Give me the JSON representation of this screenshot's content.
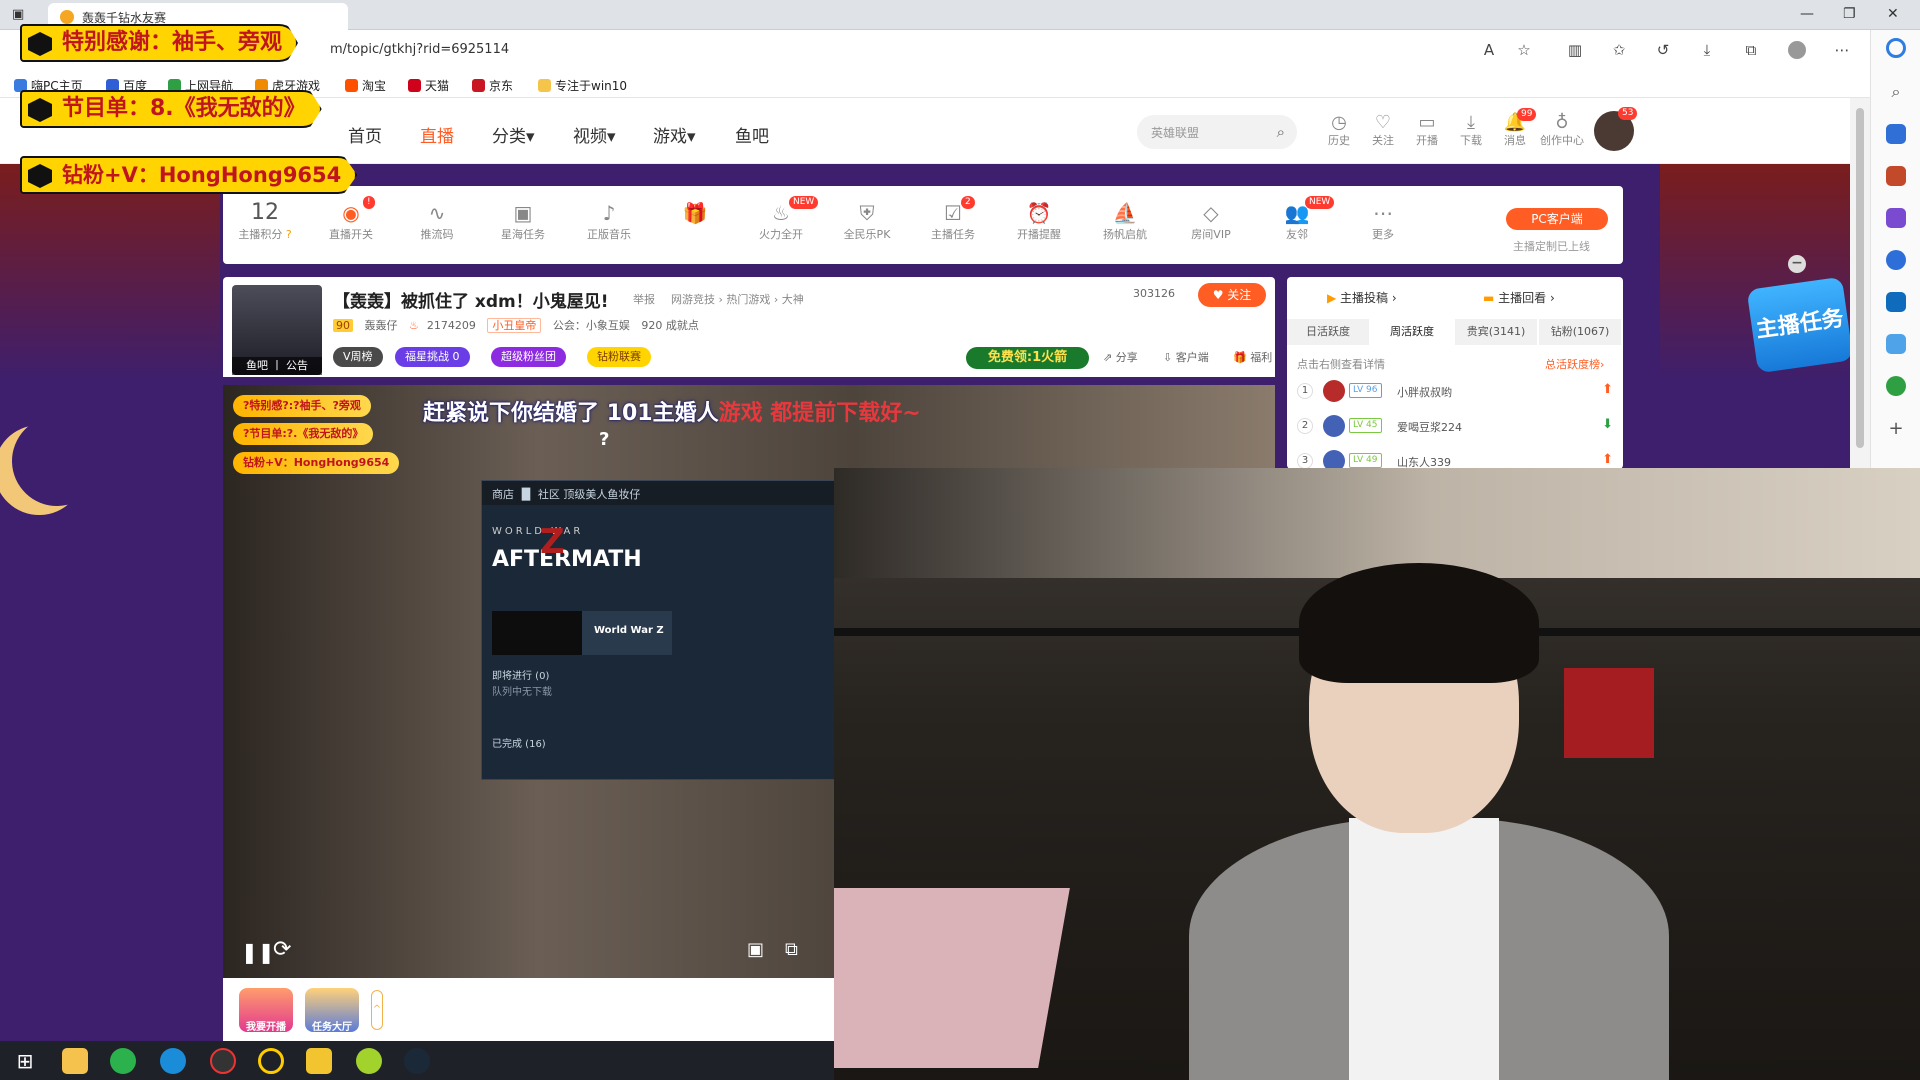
{
  "browser": {
    "tab_title": "轰轰千钻水友赛",
    "url": "m/topic/gtkhj?rid=6925114",
    "bookmarks": [
      "嗨PC主页",
      "百度",
      "上网导航",
      "虎牙游戏",
      "淘宝",
      "天猫",
      "京东",
      "专注于win10"
    ]
  },
  "overlay": {
    "line1": "特别感谢：袖手、旁观",
    "line2": "节目单：8.《我无敌的》",
    "line3": "钻粉+V：HongHong9654"
  },
  "site_header": {
    "nav": [
      "首页",
      "直播",
      "分类▾",
      "视频▾",
      "游戏▾",
      "鱼吧"
    ],
    "active_nav": "直播",
    "search_placeholder": "英雄联盟",
    "icons": [
      {
        "label": "历史",
        "icon": "clock-icon"
      },
      {
        "label": "关注",
        "icon": "heart-icon"
      },
      {
        "label": "开播",
        "icon": "camera-icon"
      },
      {
        "label": "下载",
        "icon": "download-icon"
      },
      {
        "label": "消息",
        "icon": "bell-icon",
        "badge": "99"
      },
      {
        "label": "创作中心",
        "icon": "bulb-icon"
      }
    ],
    "avatar_badge": "53"
  },
  "toolbar": {
    "score_value": "12",
    "score_label": "主播积分",
    "items": [
      {
        "label": "直播开关",
        "glyph": "◉",
        "badge": "!"
      },
      {
        "label": "推流码",
        "glyph": "∿"
      },
      {
        "label": "星海任务",
        "glyph": "▣"
      },
      {
        "label": "正版音乐",
        "glyph": "♪"
      },
      {
        "label": "",
        "glyph": "🎁"
      },
      {
        "label": "火力全开",
        "glyph": "♨",
        "badge": "NEW"
      },
      {
        "label": "全民乐PK",
        "glyph": "⛨"
      },
      {
        "label": "主播任务",
        "glyph": "☑",
        "badge": "2"
      },
      {
        "label": "开播提醒",
        "glyph": "⏰"
      },
      {
        "label": "扬帆启航",
        "glyph": "⛵"
      },
      {
        "label": "房间VIP",
        "glyph": "◇"
      },
      {
        "label": "友邻",
        "glyph": "👥",
        "badge": "NEW"
      },
      {
        "label": "更多",
        "glyph": "⋯"
      }
    ],
    "pc_client": "PC客户端",
    "pc_sub": "主播定制已上线"
  },
  "room": {
    "title": "【轰轰】被抓住了 xdm！小鬼屋见!",
    "report": "举报",
    "breadcrumbs": "网游竞技 › 热门游戏 › 大神",
    "anchor_label": "鱼吧 丨 公告",
    "level": "90",
    "anchor_name": "轰轰仔",
    "hot": "2174209",
    "vip_tag": "小丑皇帝",
    "guild": "公会：小象互娱",
    "achievements": "920 成就点",
    "pills": [
      "V周榜",
      "福星挑战 0",
      "超级粉丝团",
      "钻粉联赛"
    ],
    "follow_count": "303126",
    "follow_label": "关注",
    "free_rocket": "免费领:1火箭",
    "actions": [
      "分享",
      "客户端",
      "福利"
    ]
  },
  "player": {
    "danmu_prefix": "赶紧说下你结婚了",
    "danmu_name": "101主婚人",
    "danmu_tail": "游戏 都提前下载好~",
    "qmark": "?",
    "overlays": [
      "?特别感?:?袖手、?旁观",
      "?节目单:?.《我无敌的》",
      "钻粉+V：HongHong9654"
    ],
    "steam_nav": "商店 ▐▌ 社区 顶级美人鱼妆仔",
    "game_title_small": "WORLD WAR",
    "game_title_big": "AFTERMATH",
    "game_item": "World War Z",
    "steam_upcoming": "即将进行 (0)",
    "steam_queue": "队列中无下载",
    "steam_done": "已完成 (16)"
  },
  "footer": {
    "buttons": [
      "我要开播",
      "任务大厅"
    ]
  },
  "rank": {
    "links": [
      "主播投稿 ›",
      "主播回看 ›"
    ],
    "tabs": [
      "日活跃度",
      "周活跃度",
      "贵宾(3141)",
      "钻粉(1067)"
    ],
    "active_tab": "周活跃度",
    "tip": "点击右侧查看详情",
    "total": "总活跃度榜›",
    "rows": [
      {
        "rank": "1",
        "level": "LV 96",
        "name": "小胖叔叔哟",
        "trend": "up"
      },
      {
        "rank": "2",
        "level": "LV 45",
        "name": "爱喝豆浆224",
        "trend": "down"
      },
      {
        "rank": "3",
        "level": "LV 49",
        "name": "山东人339",
        "trend": "up"
      }
    ]
  },
  "task_badge": "主播任务",
  "colors": {
    "accent": "#ff5d23",
    "site_bg": "#3d1f6e",
    "banner_yellow": "#ffd400",
    "banner_red": "#c0151f"
  }
}
